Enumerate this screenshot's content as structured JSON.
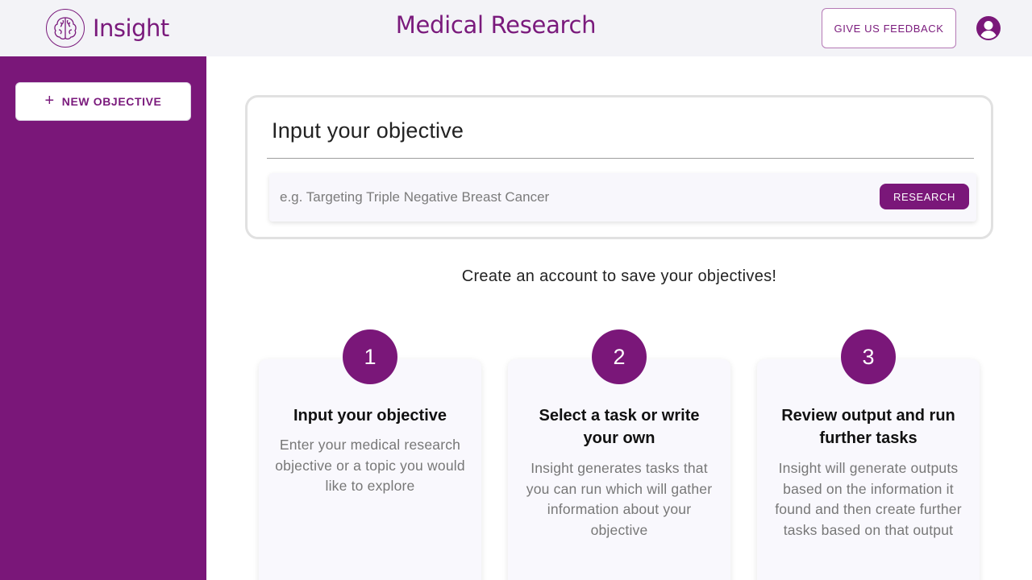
{
  "header": {
    "logo_text": "Insight",
    "title": "Medical Research",
    "feedback_label": "GIVE US FEEDBACK",
    "account_icon": "account-circle-icon"
  },
  "sidebar": {
    "new_objective_label": "NEW OBJECTIVE"
  },
  "objective": {
    "title": "Input your objective",
    "input_value": "",
    "input_placeholder": "e.g. Targeting Triple Negative Breast Cancer",
    "research_label": "RESEARCH"
  },
  "account_cta": "Create an account to save your objectives!",
  "steps": [
    {
      "number": "1",
      "title": "Input your objective",
      "description": "Enter your medical research objective or a topic you would like to explore"
    },
    {
      "number": "2",
      "title": "Select a task or write your own",
      "description": "Insight generates tasks that you can run which will gather information about your objective"
    },
    {
      "number": "3",
      "title": "Review output and run further tasks",
      "description": "Insight will generate outputs based on the information it found and then create further tasks based on that output"
    }
  ],
  "colors": {
    "brand": "#7a1779",
    "header_bg": "#f3f3f7",
    "card_bg": "#f9f8fd"
  }
}
